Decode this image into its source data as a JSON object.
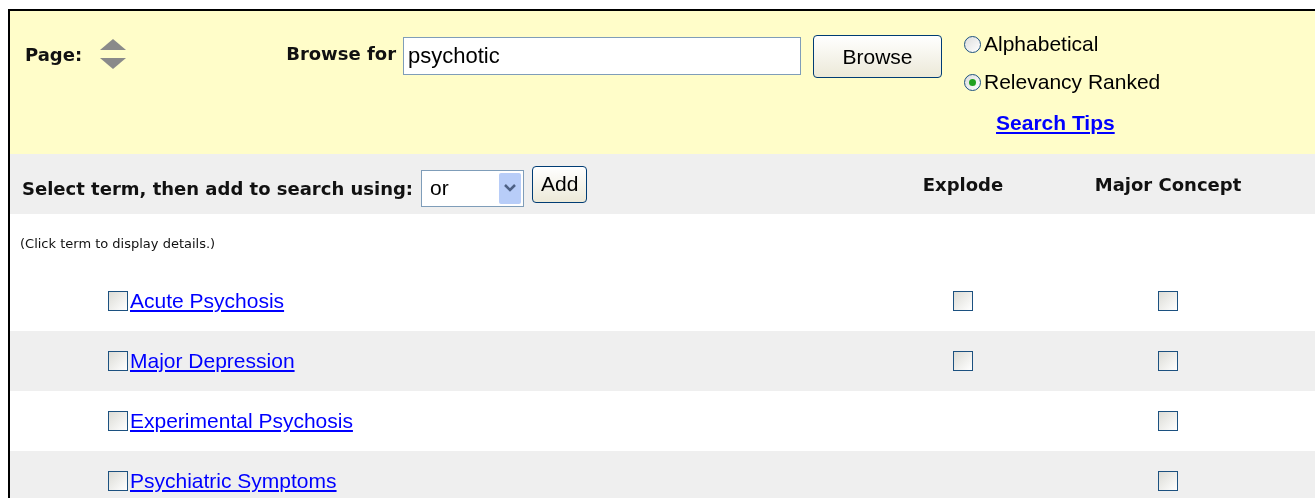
{
  "header": {
    "page_label": "Page:",
    "browse_label": "Browse for",
    "search": {
      "value": "psychotic"
    },
    "browse_button": "Browse",
    "sort_options": [
      {
        "label": "Alphabetical",
        "selected": false
      },
      {
        "label": "Relevancy Ranked",
        "selected": true
      }
    ],
    "search_tips_link": "Search Tips"
  },
  "toolbar": {
    "label": "Select term, then add to search using:",
    "operator": {
      "value": "or"
    },
    "add_button": "Add",
    "columns": [
      "Explode",
      "Major Concept"
    ]
  },
  "hint": "(Click term to display details.)",
  "terms": [
    {
      "label": "Acute Psychosis",
      "checked": false,
      "explode": {
        "checked": false
      },
      "major": {
        "checked": false
      }
    },
    {
      "label": "Major Depression",
      "checked": false,
      "explode": {
        "checked": false
      },
      "major": {
        "checked": false
      }
    },
    {
      "label": "Experimental Psychosis",
      "checked": false,
      "major": {
        "checked": false
      }
    },
    {
      "label": "Psychiatric Symptoms",
      "checked": false,
      "major": {
        "checked": false
      }
    }
  ]
}
